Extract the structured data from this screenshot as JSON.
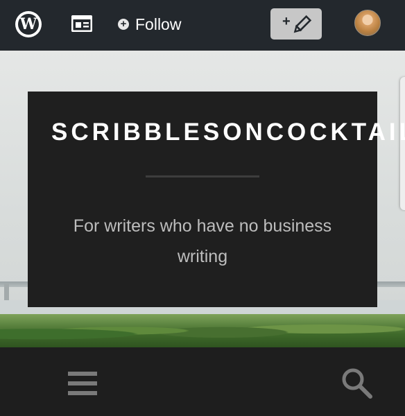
{
  "admin_bar": {
    "follow_label": "Follow",
    "write_label": "+",
    "icons": [
      "wordpress-logo-icon",
      "reader-icon",
      "follow-plus-icon",
      "pencil-icon",
      "user-avatar"
    ]
  },
  "site": {
    "title": "SCRIBBLESONCOCKTAILS",
    "tagline": "For writers who have no business writing"
  },
  "bottom_nav": {
    "icons": [
      "menu-icon",
      "search-icon"
    ]
  },
  "colors": {
    "admin_bar_bg": "#23282d",
    "panel_bg": "#1f1f1f",
    "write_button_bg": "#c7c7c7",
    "tagline_text": "#bdbdbd"
  }
}
